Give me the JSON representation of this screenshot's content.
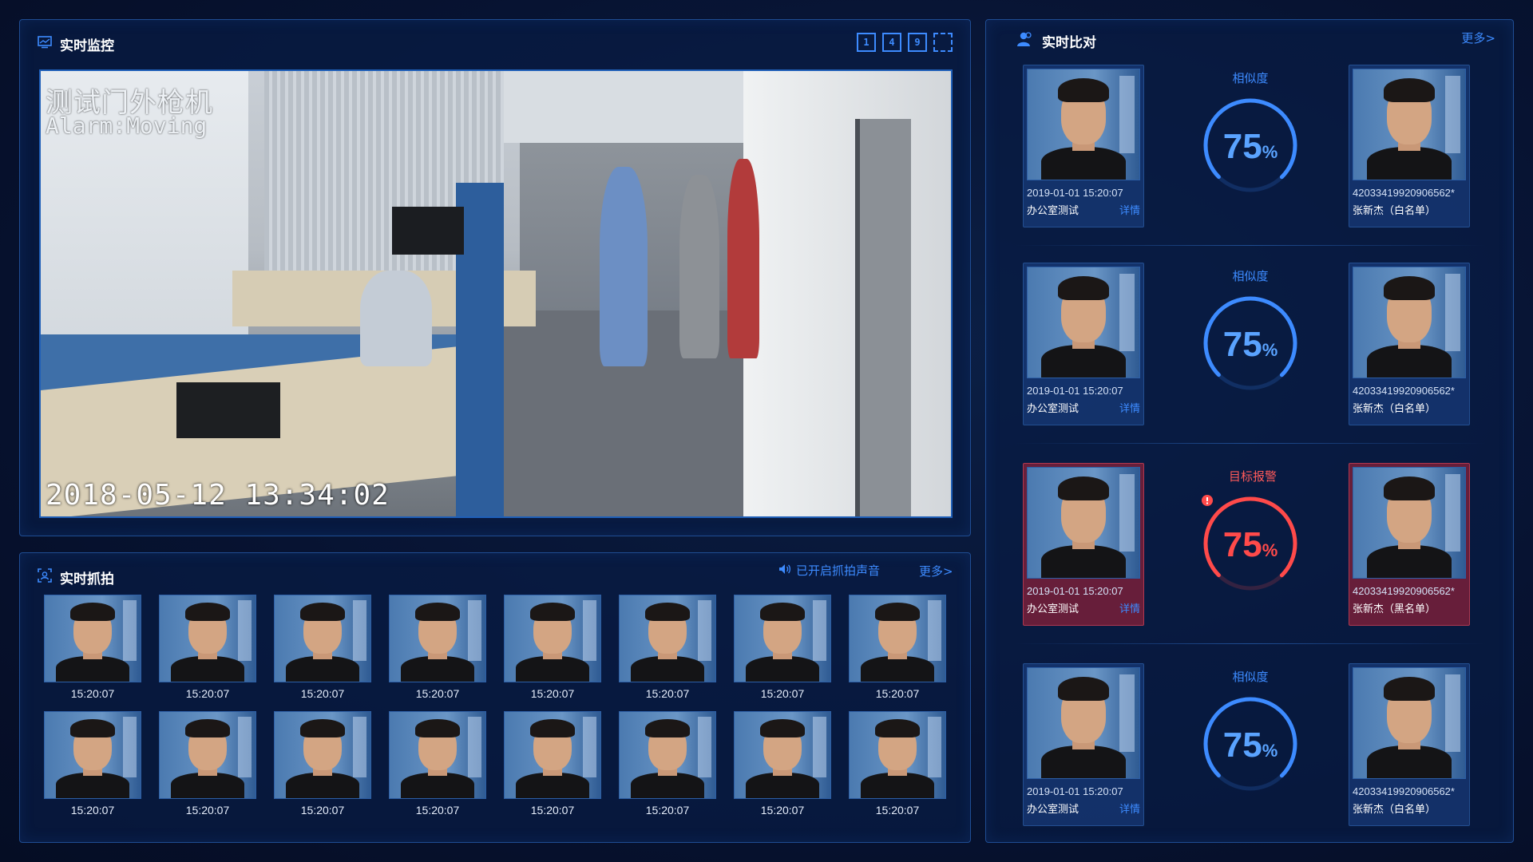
{
  "live": {
    "title": "实时监控",
    "tools": [
      "1",
      "4",
      "9",
      "⛶"
    ],
    "osd_name": "测试门外枪机",
    "osd_alarm": "Alarm:Moving",
    "osd_time": "2018-05-12 13:34:02"
  },
  "snap": {
    "title": "实时抓拍",
    "sound": "已开启抓拍声音",
    "more": "更多>",
    "items": [
      "15:20:07",
      "15:20:07",
      "15:20:07",
      "15:20:07",
      "15:20:07",
      "15:20:07",
      "15:20:07",
      "15:20:07",
      "15:20:07",
      "15:20:07",
      "15:20:07",
      "15:20:07",
      "15:20:07",
      "15:20:07",
      "15:20:07",
      "15:20:07"
    ]
  },
  "compare": {
    "title": "实时比对",
    "more": "更多>",
    "rows": [
      {
        "time": "2019-01-01  15:20:07",
        "place": "办公室测试",
        "detail": "详情",
        "caption": "相似度",
        "value": "75",
        "unit": "%",
        "alarm": false,
        "id": "42033419920906562*",
        "name": "张新杰（白名单）",
        "fraction": 0.75
      },
      {
        "time": "2019-01-01  15:20:07",
        "place": "办公室测试",
        "detail": "详情",
        "caption": "相似度",
        "value": "75",
        "unit": "%",
        "alarm": false,
        "id": "42033419920906562*",
        "name": "张新杰（白名单）",
        "fraction": 0.75
      },
      {
        "time": "2019-01-01  15:20:07",
        "place": "办公室测试",
        "detail": "详情",
        "caption": "目标报警",
        "value": "75",
        "unit": "%",
        "alarm": true,
        "id": "42033419920906562*",
        "name": "张新杰（黑名单）",
        "fraction": 0.75
      },
      {
        "time": "2019-01-01  15:20:07",
        "place": "办公室测试",
        "detail": "详情",
        "caption": "相似度",
        "value": "75",
        "unit": "%",
        "alarm": false,
        "id": "42033419920906562*",
        "name": "张新杰（白名单）",
        "fraction": 0.75
      }
    ]
  },
  "colors": {
    "accent": "#3d8bff",
    "alarm": "#ff4a4a",
    "alarm_card": "#7a2040",
    "panel_border": "#1f4d93"
  }
}
